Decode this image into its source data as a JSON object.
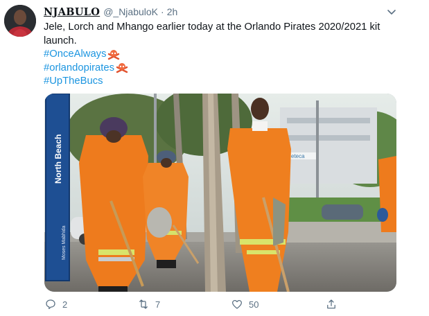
{
  "author": {
    "display_name": "NJABULO",
    "handle": "@_NjabuloK",
    "separator": "·",
    "timestamp": "2h"
  },
  "tweet": {
    "text_line1": "Jele, Lorch and Mhango earlier today at the Orlando Pirates 2020/2021 kit",
    "text_line2": "launch.",
    "hashtags": [
      "#OnceAlways",
      "#orlandopirates",
      "#UpTheBucs"
    ],
    "emoji": "skull-and-crossbones-icon"
  },
  "media": {
    "sign_text": "North Beach",
    "sign_subtext": "Moses Mabhida",
    "building_text": "eteca"
  },
  "actions": {
    "replies": "2",
    "retweets": "7",
    "likes": "50"
  },
  "colors": {
    "link": "#1b95e0",
    "muted": "#5b7083",
    "orange_uniform": "#ef7a1c"
  }
}
